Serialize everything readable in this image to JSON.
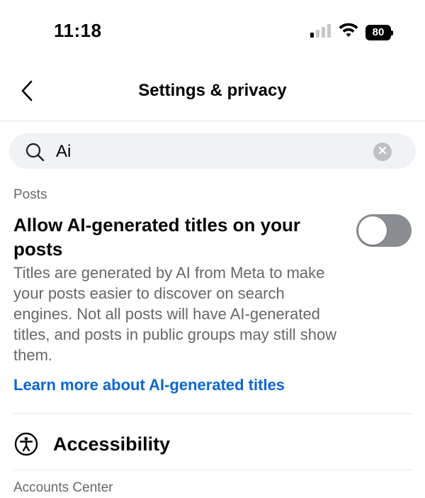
{
  "status_bar": {
    "time": "11:18",
    "battery": "80"
  },
  "nav": {
    "title": "Settings & privacy",
    "back_icon": "chevron-left-icon"
  },
  "search": {
    "value": "Ai",
    "clear_icon": "clear-icon"
  },
  "posts_section": {
    "label": "Posts",
    "setting_title": "Allow AI-generated titles on your posts",
    "toggle_state": "off",
    "description": "Titles are generated by AI from Meta to make your posts easier to discover on search engines. Not all posts will have AI-generated titles, and posts in public groups may still show them.",
    "learn_more": "Learn more about AI-generated titles"
  },
  "accessibility": {
    "label": "Accessibility",
    "icon": "accessibility-icon"
  },
  "accounts_center": {
    "label": "Accounts Center"
  },
  "colors": {
    "link": "#0a66d8",
    "secondary_text": "#65676b",
    "toggle_off": "#8a8d91",
    "search_bg": "#f0f2f5"
  }
}
